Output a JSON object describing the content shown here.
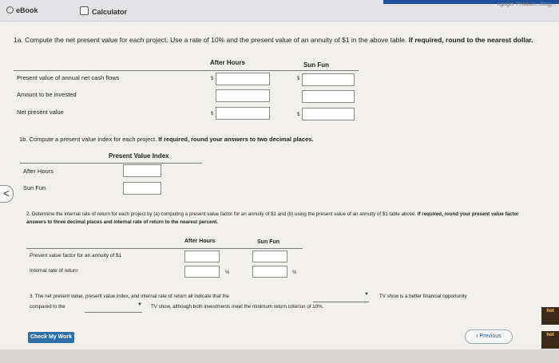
{
  "tabs": {
    "ebook": "eBook",
    "calculator": "Calculator"
  },
  "corner_text": "ngager Product...Blog...",
  "q1a": {
    "text": "1a. Compute the net present value for each project. Use a rate of 10% and the present value of an annuity of $1 in the above table.",
    "bold": "If required, round to the nearest dollar.",
    "col_after": "After Hours",
    "col_sun": "Sun Fun",
    "rows": [
      "Present value of annual net cash flows",
      "Amount to be invested",
      "Net present value"
    ],
    "dollar": "$"
  },
  "q1b": {
    "text": "1b. Compute a present value index for each project.",
    "bold": "If required, round your answers to two decimal places.",
    "header": "Present Value Index",
    "rows": [
      "After Hours",
      "Sun Fun"
    ]
  },
  "q2": {
    "text": "2. Determine the internal rate of return for each project by (a) computing a present value factor for an annuity of $1 and (b) using the present value of an annuity of $1 table above.",
    "bold": "If required, round your present value factor answers to three decimal places and internal rate of return to the nearest percent.",
    "col_after": "After Hours",
    "col_sun": "Sun Fun",
    "rows": [
      "Present value factor for an annuity of $1",
      "Internal rate of return"
    ],
    "pct": "%"
  },
  "q3": {
    "line1_a": "3. The net present value, present value index, and internal rate of return all indicate that the",
    "line1_b": "TV show is a better financial opportunity",
    "line2_a": "compared to the",
    "line2_b": "TV show, although both investments meet the minimum return criterion of 10%."
  },
  "buttons": {
    "check": "Check My Work",
    "previous": "Previous"
  },
  "side_arrow": "<",
  "thumbs": [
    "hot",
    "hot"
  ]
}
